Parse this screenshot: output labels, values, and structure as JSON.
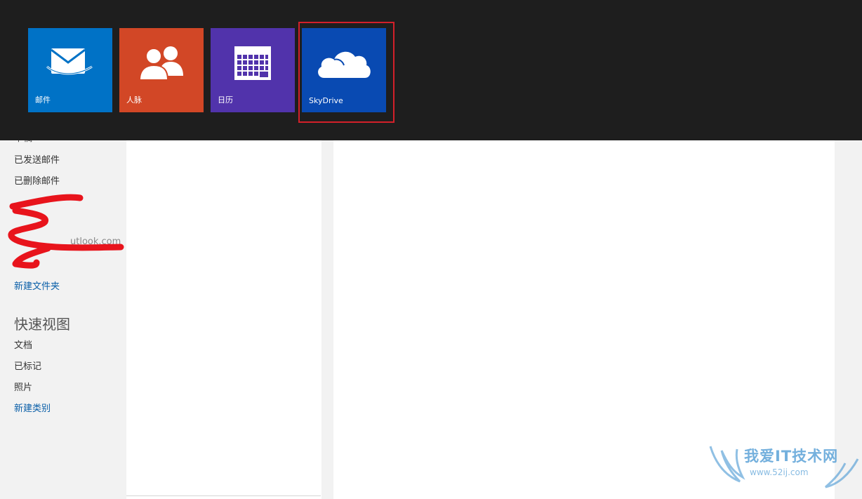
{
  "app_bar": {
    "tiles": [
      {
        "label": "邮件",
        "icon": "mail-icon",
        "color": "#0072c6"
      },
      {
        "label": "人脉",
        "icon": "people-icon",
        "color": "#d24726"
      },
      {
        "label": "日历",
        "icon": "calendar-icon",
        "color": "#5133ab"
      },
      {
        "label": "SkyDrive",
        "icon": "cloud-icon",
        "color": "#094ab2"
      }
    ],
    "highlight_color": "#d3202a"
  },
  "sidebar": {
    "folders": [
      {
        "label": "已发送邮件"
      },
      {
        "label": "已删除邮件"
      }
    ],
    "partial_top_label": "草稿",
    "redacted_text": "utlook.com",
    "new_folder_label": "新建文件夹",
    "quick_views": {
      "heading": "快速视图",
      "items": [
        {
          "label": "文档"
        },
        {
          "label": "已标记"
        },
        {
          "label": "照片"
        }
      ],
      "new_category_label": "新建类别"
    }
  },
  "watermark": {
    "title": "我爱IT技术网",
    "url": "www.52ij.com"
  }
}
